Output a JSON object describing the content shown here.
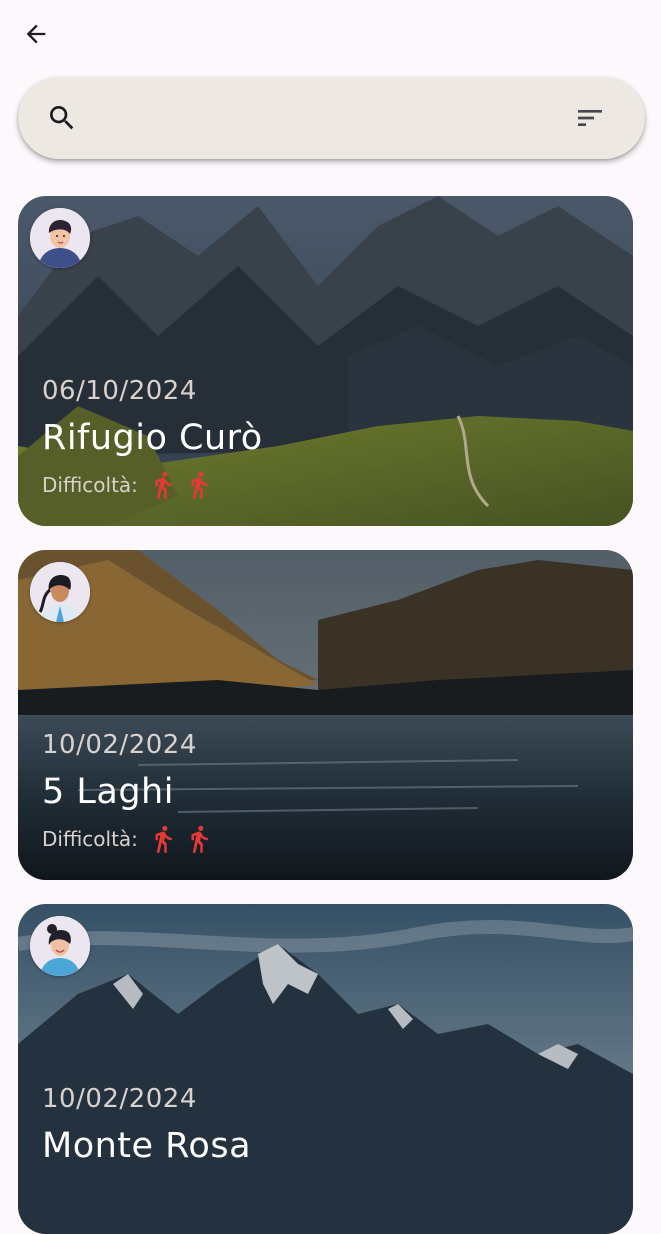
{
  "search": {
    "placeholder": "",
    "value": ""
  },
  "icons": {
    "back": "arrow-back-icon",
    "search": "search-icon",
    "filter": "sort-filter-icon",
    "difficulty": "hiker-icon"
  },
  "colors": {
    "background": "#fdf8fc",
    "search_bar": "#ede8e2",
    "difficulty_icon": "#e53935"
  },
  "excursions": [
    {
      "date": "06/10/2024",
      "title": "Rifugio Curò",
      "difficulty_label": "Difficoltà:",
      "difficulty_level": 2
    },
    {
      "date": "10/02/2024",
      "title": "5 Laghi",
      "difficulty_label": "Difficoltà:",
      "difficulty_level": 2
    },
    {
      "date": "10/02/2024",
      "title": "Monte Rosa",
      "difficulty_label": "",
      "difficulty_level": 0
    }
  ]
}
